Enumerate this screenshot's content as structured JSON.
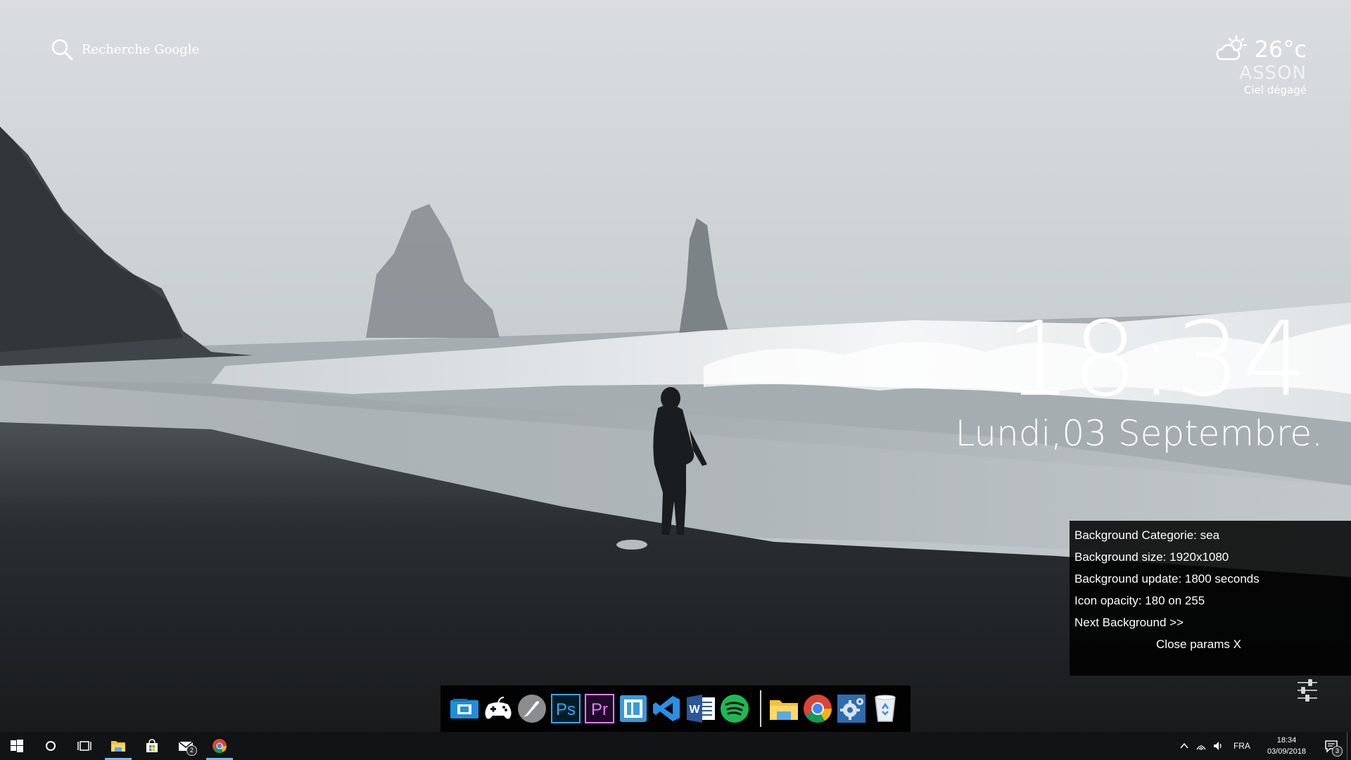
{
  "search": {
    "placeholder": "Recherche Google",
    "icon": "search-icon"
  },
  "weather": {
    "temperature": "26°c",
    "city": "ASSON",
    "condition": "Ciel dégagé",
    "icon": "partly-cloudy-icon"
  },
  "clock": {
    "time": "18:34",
    "date": "Lundi,03 Septembre."
  },
  "params": {
    "category": "Background Categorie: sea",
    "size": "Background size: 1920x1080",
    "update": "Background update: 1800 seconds",
    "opacity": "Icon opacity: 180 on 255",
    "next": "Next Background >>",
    "close": "Close params X"
  },
  "dock": {
    "apps": [
      "remote-desktop-icon",
      "gamepad-icon",
      "launchpad-rocket-icon",
      "photoshop-icon",
      "premiere-icon",
      "app-window-icon",
      "vscode-icon",
      "word-icon",
      "spotify-icon"
    ],
    "ps_label": "Ps",
    "pr_label": "Pr",
    "word_label": "W",
    "system": [
      "file-explorer-icon",
      "chrome-icon",
      "settings-gear-icon",
      "recycle-bin-icon"
    ]
  },
  "taskbar": {
    "mail_badge": "2",
    "language": "FRA",
    "time": "18:34",
    "date": "03/09/2018",
    "notification_count": "3"
  },
  "colors": {
    "accent": "#76b9ed",
    "photoshop": "#31a8ff",
    "premiere": "#e77bff",
    "spotify": "#1db954",
    "vscode": "#2a8fe6"
  }
}
